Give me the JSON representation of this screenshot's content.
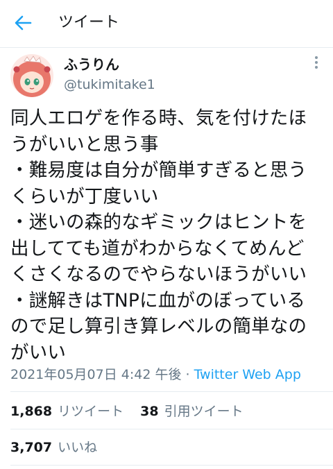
{
  "header": {
    "title": "ツイート"
  },
  "tweet": {
    "author_name": "ふうりん",
    "author_handle": "@tukimitake1",
    "lines": [
      "同人エロゲを作る時、気を付けたほ",
      "うがいいと思う事",
      "・難易度は自分が簡単すぎると思う",
      "くらいが丁度いい",
      "・迷いの森的なギミックはヒントを",
      "出してても道がわからなくてめんど",
      "くさくなるのでやらないほうがいい",
      "・謎解きはTNPに血がのぼっている",
      "ので足し算引き算レベルの簡単なの",
      "がいい"
    ],
    "timestamp": "2021年05月07日 4:42 午後",
    "separator": " · ",
    "source": "Twitter Web App"
  },
  "stats": {
    "retweets_count": "1,868",
    "retweets_label": "リツイート",
    "quotes_count": "38",
    "quotes_label": "引用ツイート",
    "likes_count": "3,707",
    "likes_label": "いいね"
  },
  "colors": {
    "accent": "#1da1f2",
    "muted": "#657786",
    "text": "#14171a",
    "border": "#e6ecf0"
  }
}
